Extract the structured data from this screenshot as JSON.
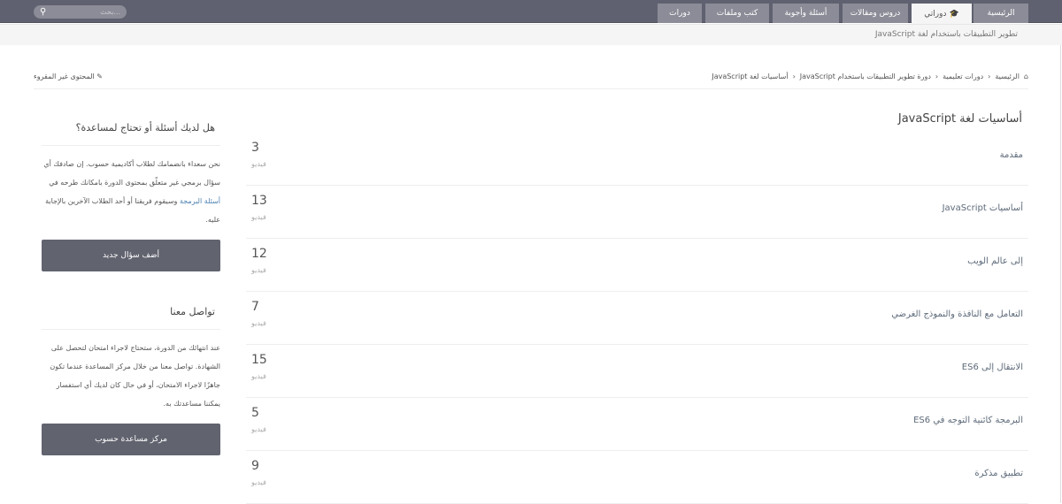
{
  "nav": {
    "tabs": [
      {
        "label": "الرئيسية",
        "active": false
      },
      {
        "label": "دوراتي",
        "active": true,
        "icon": "graduation-cap-icon"
      },
      {
        "label": "دروس ومقالات",
        "active": false
      },
      {
        "label": "أسئلة وأجوبة",
        "active": false
      },
      {
        "label": "كتب وملفات",
        "active": false
      },
      {
        "label": "دورات",
        "active": false
      }
    ],
    "search_placeholder": "بحث..."
  },
  "subbar": {
    "course_title": "تطوير التطبيقات باستخدام لغة JavaScript"
  },
  "breadcrumb": [
    "الرئيسية",
    "دورات تعليمية",
    "دورة تطوير التطبيقات باستخدام JavaScript",
    "أساسيات لغة JavaScript"
  ],
  "unread_link": "المحتوى غير المقروء",
  "main": {
    "title": "أساسيات لغة JavaScript",
    "unit": "فيديو",
    "lessons": [
      {
        "title": "مقدمة",
        "count": "3"
      },
      {
        "title": "أساسيات JavaScript",
        "count": "13"
      },
      {
        "title": "إلى عالم الويب",
        "count": "12"
      },
      {
        "title": "التعامل مع النافذة والنموذج الغرضي",
        "count": "7"
      },
      {
        "title": "الانتقال إلى ES6",
        "count": "15"
      },
      {
        "title": "البرمجة كائنية التوجه في ES6",
        "count": "5"
      },
      {
        "title": "تطبيق مذكرة",
        "count": "9"
      }
    ]
  },
  "sidebar": {
    "help": {
      "title": "هل لديك أسئلة أو تحتاج لمساعدة؟",
      "text1": "نحن سعداء بانضمامك لطلاب أكاديمية حسوب. إن صادفك أي سؤال برمجي غير متعلّق بمحتوى الدورة بامكانك طرحه في ",
      "link": "أسئلة البرمجة",
      "text2": " وسيقوم فريقنا أو أحد الطلاب الآخرين بالإجابة عليه.",
      "button": "أضف سؤال جديد"
    },
    "contact": {
      "title": "تواصل معنا",
      "text": "عند انتهائك من الدورة، ستحتاج لاجراء امتحان لتحصل على الشهادة. تواصل معنا من خلال مركز المساعدة عندما تكون جاهزًا لاجراء الامتحان، أو في حال كان لديك أي استفسار يمكننا مساعدتك به.",
      "button": "مركز مساعدة حسوب"
    }
  }
}
